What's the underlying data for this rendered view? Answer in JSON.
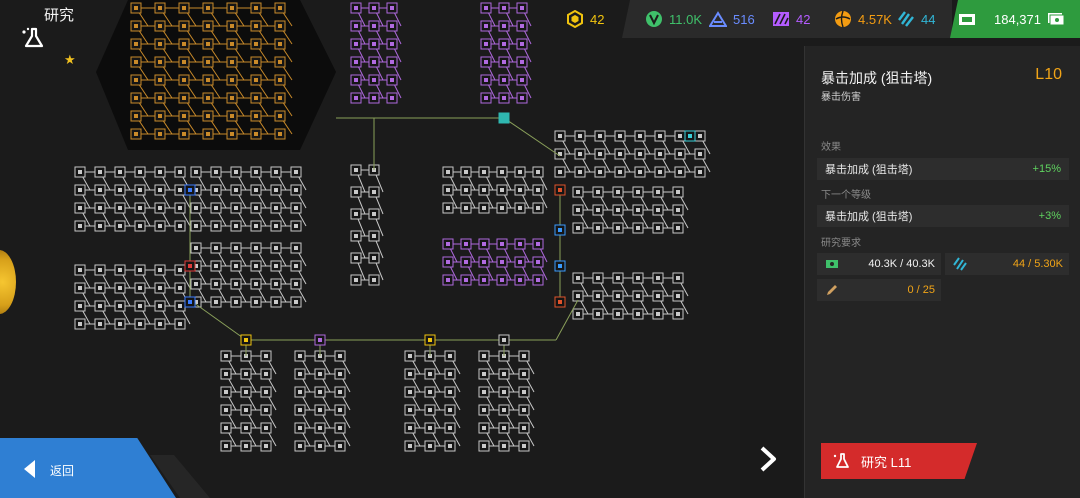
{
  "header": {
    "title": "研究",
    "title_icon": "flask-icon",
    "star_icon": "star-icon"
  },
  "resources": [
    {
      "name": "hex-token",
      "icon": "hexagon-badge-icon",
      "value": "42",
      "color": "#f1c40f"
    },
    {
      "name": "green-scale",
      "icon": "green-circle-icon",
      "value": "11.0K",
      "color": "#3fc06a"
    },
    {
      "name": "blue-chart",
      "icon": "blue-chart-icon",
      "value": "516",
      "color": "#6a8cff"
    },
    {
      "name": "purple-stripes",
      "icon": "purple-stripes-icon",
      "value": "42",
      "color": "#b45cff"
    },
    {
      "name": "orange-ball",
      "icon": "orange-ball-icon",
      "value": "4.57K",
      "color": "#f39c12"
    },
    {
      "name": "cyan-stripes",
      "icon": "cyan-stripes-icon",
      "value": "44",
      "color": "#31b6d6"
    },
    {
      "name": "cash",
      "icon": "cash-icon",
      "value": "184,371",
      "color": "#ffffff"
    }
  ],
  "panel": {
    "name": "暴击加成 (狙击塔)",
    "level": "L10",
    "subtitle": "暴击伤害",
    "effect_header": "效果",
    "effect_label": "暴击加成 (狙击塔)",
    "effect_value": "+15%",
    "next_header": "下一个等级",
    "next_label": "暴击加成 (狙击塔)",
    "next_value": "+3%",
    "req_header": "研究要求",
    "req_money": "40.3K / 40.3K",
    "req_stripes": "44 / 5.30K",
    "req_other": "0 / 25"
  },
  "research_button": {
    "label": "研究 L11",
    "icon": "flask-icon"
  },
  "next_button": {
    "icon": "chevron-right-icon"
  },
  "back_button": {
    "label": "返回",
    "icon": "chevron-left-icon"
  }
}
